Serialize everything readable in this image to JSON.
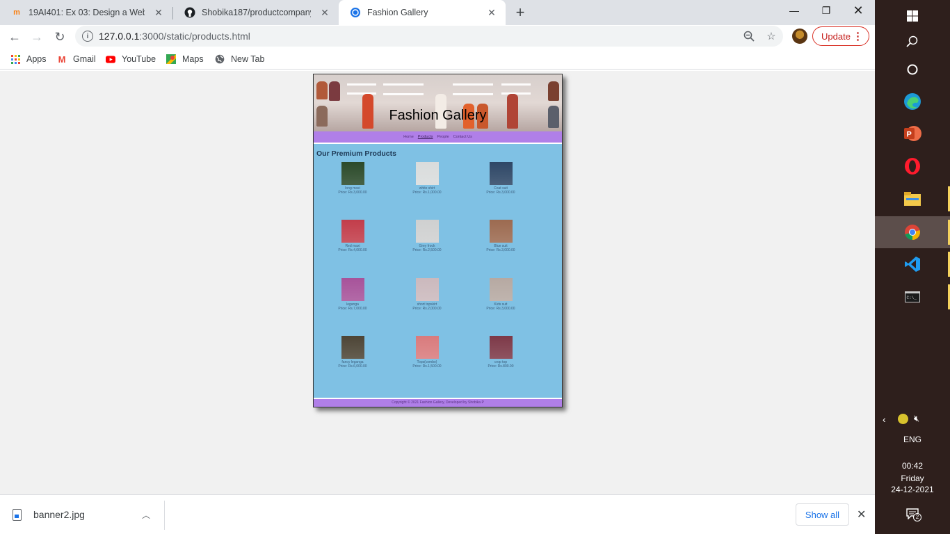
{
  "browser": {
    "tabs": [
      {
        "title": "19AI401: Ex 03: Design a Website",
        "icon": "moodle-icon"
      },
      {
        "title": "Shobika187/productcompanywel",
        "icon": "github-icon"
      },
      {
        "title": "Fashion Gallery",
        "icon": "site-icon"
      }
    ],
    "url_host": "127.0.0.1",
    "url_path": ":3000/static/products.html",
    "update_label": "Update",
    "bookmarks": [
      {
        "label": "Apps",
        "icon": "apps-grid-icon"
      },
      {
        "label": "Gmail",
        "icon": "gmail-icon"
      },
      {
        "label": "YouTube",
        "icon": "youtube-icon"
      },
      {
        "label": "Maps",
        "icon": "maps-icon"
      },
      {
        "label": "New Tab",
        "icon": "globe-icon"
      }
    ]
  },
  "site": {
    "banner_title": "Fashion Gallery",
    "nav": [
      {
        "label": "Home",
        "active": false
      },
      {
        "label": "Products",
        "active": true
      },
      {
        "label": "People",
        "active": false
      },
      {
        "label": "Contact Us",
        "active": false
      }
    ],
    "heading": "Our Premium Products",
    "products": [
      {
        "name": "long maxi",
        "price": "Price: Rs.3,000.00",
        "color": "#2b4a2a"
      },
      {
        "name": "white shirt",
        "price": "Price: Rs.1,000.00",
        "color": "#d9dcdc"
      },
      {
        "name": "Coat suit",
        "price": "Price: Rs.3,000.00",
        "color": "#2e4766"
      },
      {
        "name": "Red maxi",
        "price": "Price: Rs.4,000.00",
        "color": "#c23d4a"
      },
      {
        "name": "Grey frock",
        "price": "Price: Rs.2,500.00",
        "color": "#cfd0d0"
      },
      {
        "name": "Blue suit",
        "price": "Price: Rs.3,000.00",
        "color": "#9c6a50"
      },
      {
        "name": "leganga",
        "price": "Price: Rs.7,000.00",
        "color": "#a7539a"
      },
      {
        "name": "short topskirt",
        "price": "Price: Rs.2,000.00",
        "color": "#cbb9bd"
      },
      {
        "name": "Kids suit",
        "price": "Price: Rs.3,000.00",
        "color": "#b6a9a2"
      },
      {
        "name": "fancy leganga",
        "price": "Price: Rs.6,000.00",
        "color": "#4d4536"
      },
      {
        "name": "Tops(combo)",
        "price": "Price: Rs.1,500.00",
        "color": "#d97b7d"
      },
      {
        "name": "crop top",
        "price": "Price: Rs.800.00",
        "color": "#7d3948"
      }
    ],
    "footer": "Copyright © 2021 Fashion Gallery, Developed by Shobika P"
  },
  "downloads": {
    "file_name": "banner2.jpg",
    "show_all": "Show all"
  },
  "taskbar": {
    "language": "ENG",
    "time": "00:42",
    "day": "Friday",
    "date": "24-12-2021",
    "notification_count": "2"
  }
}
